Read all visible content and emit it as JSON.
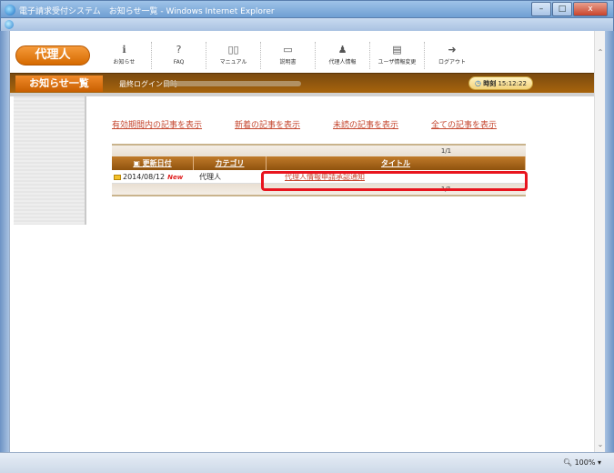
{
  "window": {
    "title": "電子請求受付システム　お知らせ一覧 - Windows Internet Explorer",
    "buttons": {
      "minimize": "–",
      "maximize": "□",
      "close": "x"
    }
  },
  "header": {
    "brand": "代理人",
    "nav": [
      {
        "label": "お知らせ",
        "icon": "info-icon"
      },
      {
        "label": "FAQ",
        "icon": "faq-icon"
      },
      {
        "label": "マニュアル",
        "icon": "book-icon"
      },
      {
        "label": "説明書",
        "icon": "document-icon"
      },
      {
        "label": "代理人情報",
        "icon": "person-icon"
      },
      {
        "label": "ユーザ情報変更",
        "icon": "id-card-icon"
      },
      {
        "label": "ログアウト",
        "icon": "logout-icon"
      }
    ]
  },
  "subbar": {
    "page_title": "お知らせ一覧",
    "last_login_label": "最終ログイン日時",
    "clock_label": "時刻",
    "clock_time": "15:12:22"
  },
  "filters": [
    "有効期間内の記事を表示",
    "新着の記事を表示",
    "未読の記事を表示",
    "全ての記事を表示"
  ],
  "table": {
    "pager_top": "1/1",
    "pager_bottom": "1/1",
    "headers": {
      "date": "更新日付",
      "category": "カテゴリ",
      "title": "タイトル"
    },
    "rows": [
      {
        "date": "2014/08/12",
        "new_badge": "New",
        "category": "代理人",
        "title": "代理人情報申請承認通知"
      }
    ]
  },
  "statusbar": {
    "zoom": "100%"
  }
}
